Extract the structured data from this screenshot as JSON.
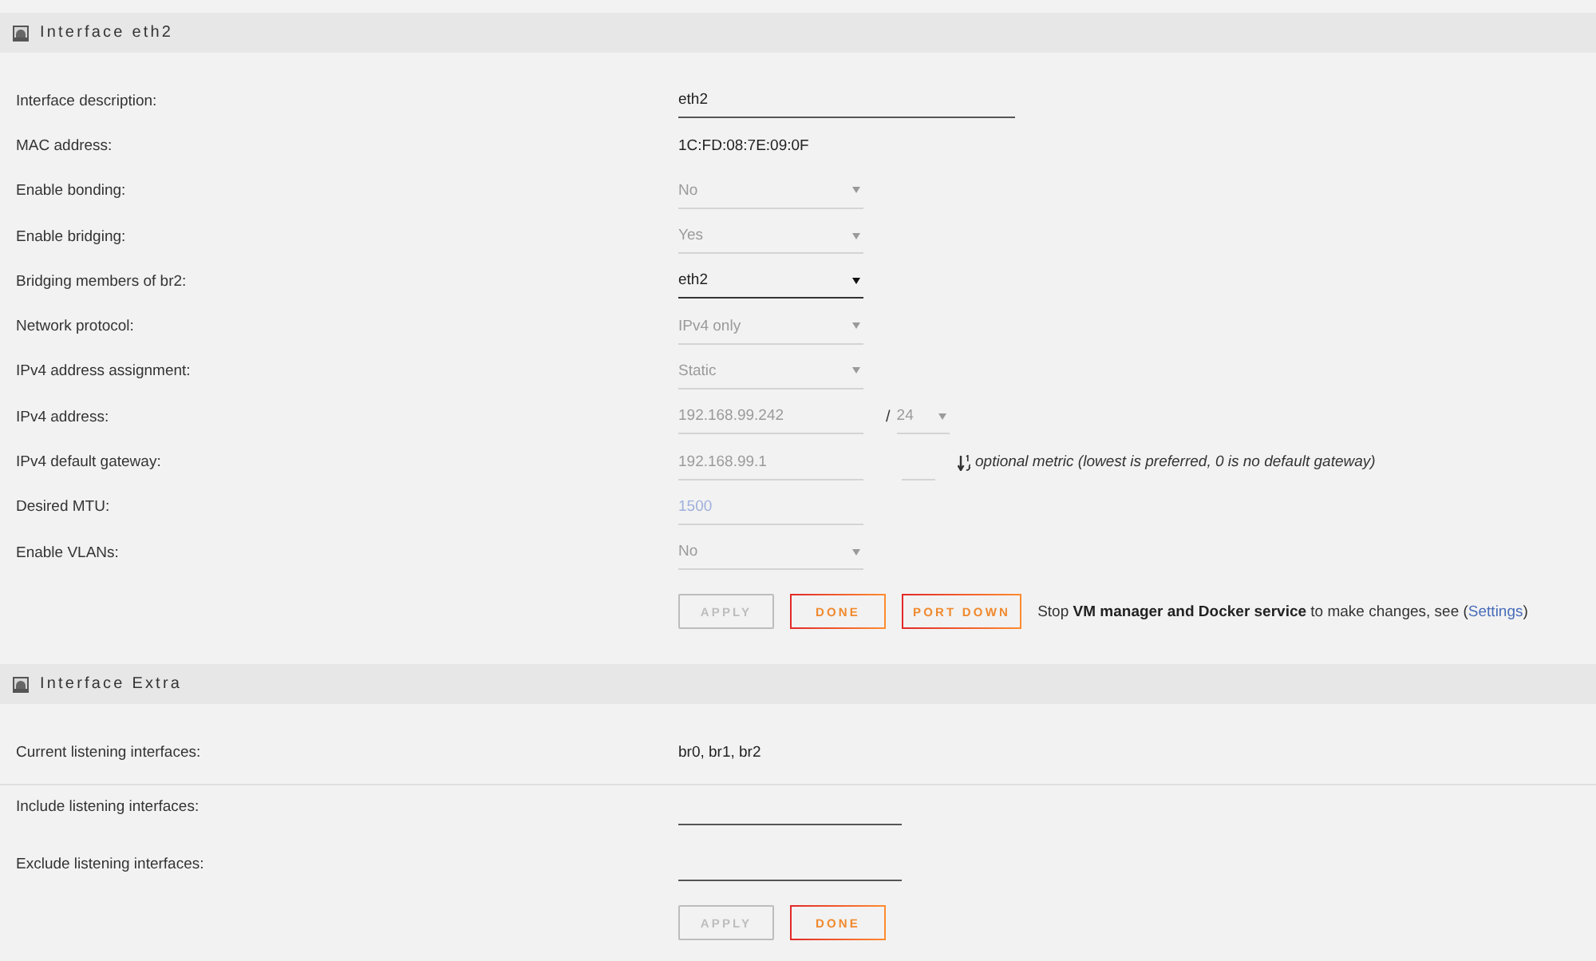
{
  "sections": [
    {
      "title": "Interface eth2",
      "rows": [
        {
          "kind": "text",
          "label": "Interface description:",
          "value": "eth2",
          "disabled": false
        },
        {
          "kind": "info",
          "label": "MAC address:",
          "value": "1C:FD:08:7E:09:0F"
        },
        {
          "kind": "select",
          "label": "Enable bonding:",
          "value": "No",
          "disabled": true
        },
        {
          "kind": "select",
          "label": "Enable bridging:",
          "value": "Yes",
          "disabled": true
        },
        {
          "kind": "select",
          "label": "Bridging members of br2:",
          "value": "eth2",
          "disabled": false
        },
        {
          "kind": "select",
          "label": "Network protocol:",
          "value": "IPv4 only",
          "disabled": true
        },
        {
          "kind": "select",
          "label": "IPv4 address assignment:",
          "value": "Static",
          "disabled": true
        },
        {
          "kind": "address",
          "label": "IPv4 address:",
          "value": "192.168.99.242",
          "separator": "/",
          "netmask": "24",
          "disabled": true
        },
        {
          "kind": "gateway",
          "label": "IPv4 default gateway:",
          "value": "192.168.99.1",
          "note": "optional metric (lowest is preferred, 0 is no default gateway)",
          "disabled": true
        },
        {
          "kind": "number",
          "label": "Desired MTU:",
          "placeholder": "1500",
          "disabled": true
        },
        {
          "kind": "select",
          "label": "Enable VLANs:",
          "value": "No",
          "disabled": true
        }
      ],
      "buttons": [
        {
          "label": "APPLY",
          "disabled": true
        },
        {
          "label": "DONE",
          "disabled": false
        },
        {
          "label": "PORT DOWN",
          "disabled": false
        }
      ],
      "notice": {
        "text": "Stop **VM manager and Docker service** to make changes, see (",
        "link": "Settings",
        "after": ")"
      }
    },
    {
      "title": "Interface Extra",
      "rows": [
        {
          "kind": "info",
          "label": "Current listening interfaces:",
          "value": "br0, br1, br2",
          "divider": true
        },
        {
          "kind": "list",
          "label": "Include listening interfaces:",
          "disabled": false
        },
        {
          "kind": "list",
          "label": "Exclude listening interfaces:",
          "disabled": false
        }
      ],
      "buttons": [
        {
          "label": "APPLY",
          "disabled": true
        },
        {
          "label": "DONE",
          "disabled": false
        }
      ]
    }
  ]
}
